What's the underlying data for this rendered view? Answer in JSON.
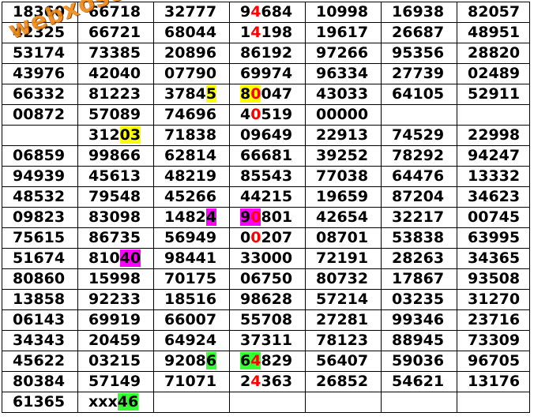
{
  "watermark": "webxoso.net",
  "colors": {
    "yellow": "#ffff00",
    "magenta": "#ff00ff",
    "green": "#33ff33",
    "red": "#ff0000"
  },
  "rows": [
    [
      [
        "18360"
      ],
      [
        "66718"
      ],
      [
        "32777"
      ],
      [
        "9",
        [
          "4",
          "red"
        ],
        "684"
      ],
      [
        "10998"
      ],
      [
        "16938"
      ],
      [
        "82057"
      ]
    ],
    [
      [
        "42325"
      ],
      [
        "66721"
      ],
      [
        "68044"
      ],
      [
        "1",
        [
          "4",
          "red"
        ],
        "198"
      ],
      [
        "19617"
      ],
      [
        "26687"
      ],
      [
        "48951"
      ]
    ],
    [
      [
        "53174"
      ],
      [
        "73385"
      ],
      [
        "20896"
      ],
      [
        "86192"
      ],
      [
        "97266"
      ],
      [
        "95356"
      ],
      [
        "28820"
      ]
    ],
    [
      [
        "43976"
      ],
      [
        "42040"
      ],
      [
        "07790"
      ],
      [
        "69974"
      ],
      [
        "96334"
      ],
      [
        "27739"
      ],
      [
        "02489"
      ]
    ],
    [
      [
        "66332"
      ],
      [
        "81223"
      ],
      [
        "3784",
        [
          "5",
          "hl-yellow"
        ]
      ],
      [
        [
          "8",
          "hl-yellow"
        ],
        [
          "0",
          "hl-yellow red"
        ],
        "047"
      ],
      [
        "43033"
      ],
      [
        "64105"
      ],
      [
        "52911"
      ]
    ],
    [
      [
        "00872"
      ],
      [
        "57089"
      ],
      [
        "74696"
      ],
      [
        "4",
        [
          "0",
          "red"
        ],
        "519"
      ],
      [
        "00000"
      ],
      [
        ""
      ],
      [
        ""
      ]
    ],
    [
      [
        ""
      ],
      [
        "312",
        [
          "03",
          "hl-yellow"
        ]
      ],
      [
        "71838"
      ],
      [
        "09649"
      ],
      [
        "22913"
      ],
      [
        "74529"
      ],
      [
        "22998"
      ]
    ],
    [
      [
        "06859"
      ],
      [
        "99866"
      ],
      [
        "62814"
      ],
      [
        "66681"
      ],
      [
        "39252"
      ],
      [
        "78292"
      ],
      [
        "94247"
      ]
    ],
    [
      [
        "94939"
      ],
      [
        "45613"
      ],
      [
        "48219"
      ],
      [
        "85543"
      ],
      [
        "77038"
      ],
      [
        "64476"
      ],
      [
        "13332"
      ]
    ],
    [
      [
        "48532"
      ],
      [
        "79548"
      ],
      [
        "45266"
      ],
      [
        "44215"
      ],
      [
        "19659"
      ],
      [
        "87204"
      ],
      [
        "34623"
      ]
    ],
    [
      [
        "09823"
      ],
      [
        "83098"
      ],
      [
        "1482",
        [
          "4",
          "hl-magenta"
        ]
      ],
      [
        [
          "9",
          "hl-magenta"
        ],
        [
          "0",
          "hl-magenta red"
        ],
        "801"
      ],
      [
        "42654"
      ],
      [
        "32217"
      ],
      [
        "00745"
      ]
    ],
    [
      [
        "75615"
      ],
      [
        "86735"
      ],
      [
        "56949"
      ],
      [
        "0",
        [
          "0",
          "red"
        ],
        "207"
      ],
      [
        "08701"
      ],
      [
        "53838"
      ],
      [
        "63995"
      ]
    ],
    [
      [
        "51674"
      ],
      [
        "810",
        [
          "40",
          "hl-magenta"
        ]
      ],
      [
        "98441"
      ],
      [
        "33000"
      ],
      [
        "72191"
      ],
      [
        "28263"
      ],
      [
        "34365"
      ]
    ],
    [
      [
        "80860"
      ],
      [
        "15998"
      ],
      [
        "70175"
      ],
      [
        "06750"
      ],
      [
        "80732"
      ],
      [
        "17867"
      ],
      [
        "93508"
      ]
    ],
    [
      [
        "13858"
      ],
      [
        "92233"
      ],
      [
        "18516"
      ],
      [
        "98628"
      ],
      [
        "57214"
      ],
      [
        "03235"
      ],
      [
        "31270"
      ]
    ],
    [
      [
        "06143"
      ],
      [
        "69919"
      ],
      [
        "66007"
      ],
      [
        "55708"
      ],
      [
        "27281"
      ],
      [
        "99346"
      ],
      [
        "23716"
      ]
    ],
    [
      [
        "34343"
      ],
      [
        "20459"
      ],
      [
        "64924"
      ],
      [
        "37311"
      ],
      [
        "78123"
      ],
      [
        "88945"
      ],
      [
        "73309"
      ]
    ],
    [
      [
        "45622"
      ],
      [
        "03215"
      ],
      [
        "9208",
        [
          "6",
          "hl-green"
        ]
      ],
      [
        [
          "6",
          "hl-green"
        ],
        [
          "4",
          "hl-green red"
        ],
        "829"
      ],
      [
        "56407"
      ],
      [
        "59036"
      ],
      [
        "96705"
      ]
    ],
    [
      [
        "80384"
      ],
      [
        "57149"
      ],
      [
        "71071"
      ],
      [
        "2",
        [
          "4",
          "red"
        ],
        "363"
      ],
      [
        "26852"
      ],
      [
        "54621"
      ],
      [
        "13176"
      ]
    ],
    [
      [
        "61365"
      ],
      [
        "xxx",
        [
          "46",
          "hl-green"
        ]
      ],
      [
        ""
      ],
      [
        ""
      ],
      [
        ""
      ],
      [
        ""
      ],
      [
        ""
      ]
    ]
  ]
}
